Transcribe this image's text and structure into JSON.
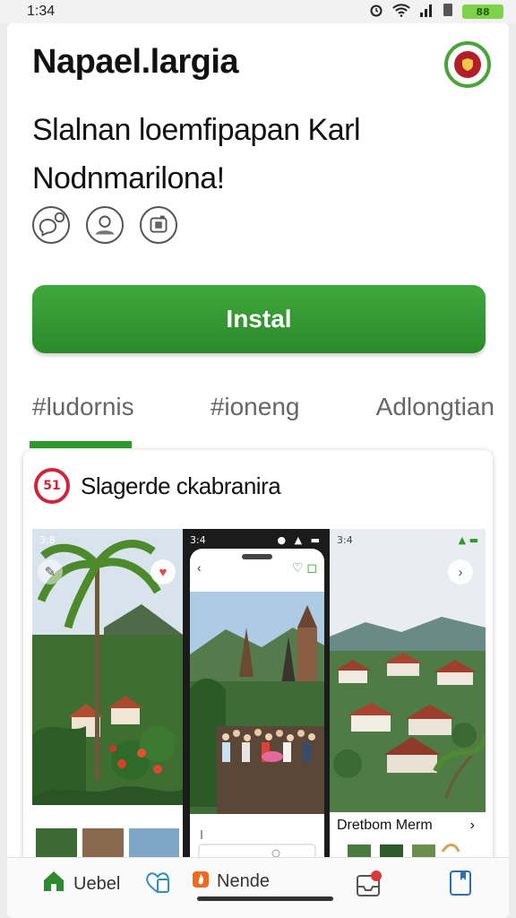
{
  "status_bar": {
    "time": "1:34",
    "battery_text": "88"
  },
  "header": {
    "app_title": "Napael.largia",
    "subtitle": "Slalnan loemfipapan Karl Nodnmarilona!"
  },
  "install_label": "Instal",
  "tabs": [
    {
      "label": "#ludornis",
      "active": true
    },
    {
      "label": "#ioneng",
      "active": false
    },
    {
      "label": "Adlongtian",
      "active": false
    }
  ],
  "card": {
    "logo_text": "51",
    "title": "Slagerde ckabranira",
    "screenshots": {
      "s1_status_time": "3:8",
      "s2_status_time": "3:4",
      "s3_status_time": "3:4",
      "s3_caption": "Dretbom Merm"
    }
  },
  "bottom_nav": {
    "item1_label": "Uebel",
    "item2_label": "Nende"
  },
  "colors": {
    "accent": "#2e9a2e",
    "install_button": "#34982f",
    "logo_red": "#d0243a"
  }
}
